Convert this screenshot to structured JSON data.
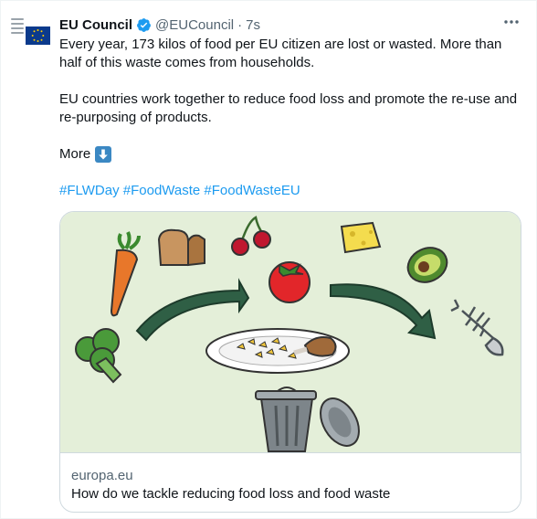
{
  "account": {
    "name": "EU Council",
    "handle": "@EUCouncil",
    "separator": "·",
    "time": "7s"
  },
  "tweet": {
    "paragraph1": "Every year, 173 kilos of food per EU citizen are lost or wasted. More than half of this waste comes from households.",
    "paragraph2": "EU countries work together to reduce food loss and promote the re-use and re-purposing of products.",
    "more_label": "More",
    "more_icon": "down-arrow-emoji",
    "hashtags": [
      "#FLWDay",
      "#FoodWaste",
      "#FoodWasteEU"
    ]
  },
  "card": {
    "domain": "europa.eu",
    "title": "How do we tackle reducing food loss and food waste"
  },
  "colors": {
    "link": "#1d9bf0",
    "verified": "#1d9bf0",
    "card_bg": "#e4efd9",
    "arrow": "#2f5f45"
  }
}
